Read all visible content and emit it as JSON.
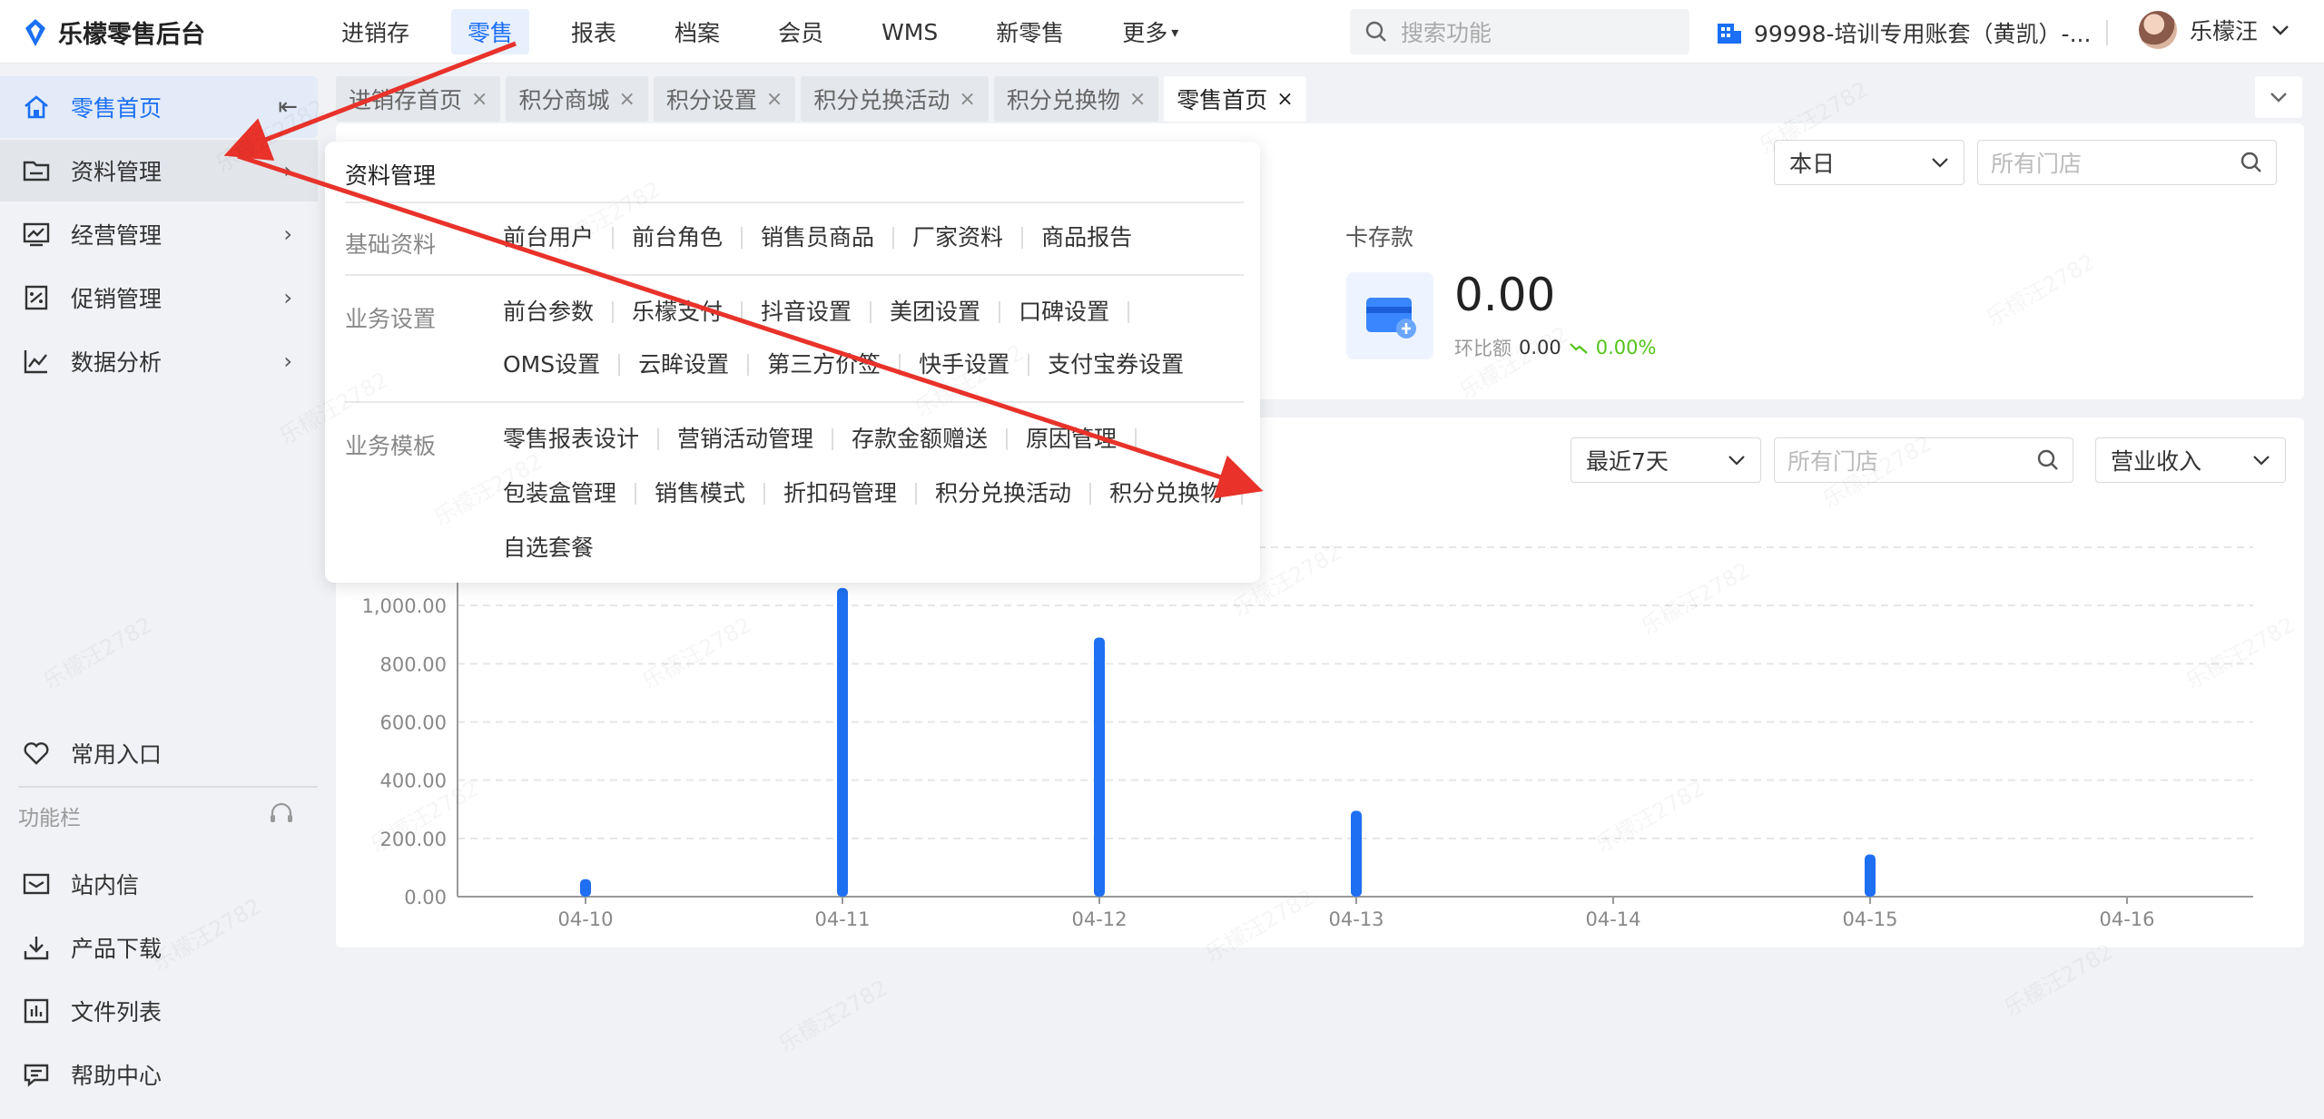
{
  "app": {
    "title": "乐檬零售后台"
  },
  "topnav": {
    "items": [
      {
        "label": "进销存"
      },
      {
        "label": "零售"
      },
      {
        "label": "报表"
      },
      {
        "label": "档案"
      },
      {
        "label": "会员"
      },
      {
        "label": "WMS"
      },
      {
        "label": "新零售"
      },
      {
        "label": "更多"
      }
    ],
    "search_placeholder": "搜索功能",
    "account": "99998-培训专用账套（黄凯）-...",
    "user": "乐檬汪"
  },
  "sidebar": {
    "items": [
      {
        "label": "零售首页"
      },
      {
        "label": "资料管理"
      },
      {
        "label": "经营管理"
      },
      {
        "label": "促销管理"
      },
      {
        "label": "数据分析"
      }
    ],
    "favorite": "常用入口",
    "section_label": "功能栏",
    "bottom": [
      {
        "label": "站内信"
      },
      {
        "label": "产品下载"
      },
      {
        "label": "文件列表"
      },
      {
        "label": "帮助中心"
      }
    ]
  },
  "tabs": [
    {
      "label": "进销存首页"
    },
    {
      "label": "积分商城"
    },
    {
      "label": "积分设置"
    },
    {
      "label": "积分兑换活动"
    },
    {
      "label": "积分兑换物"
    },
    {
      "label": "零售首页"
    }
  ],
  "summary": {
    "period": "本日",
    "store_placeholder": "所有门店",
    "card_label": "卡存款",
    "card_value": "0.00",
    "compare_label": "环比额",
    "compare_value": "0.00",
    "compare_pct": "0.00%"
  },
  "trend": {
    "period": "最近7天",
    "store_placeholder": "所有门店",
    "metric": "营业收入"
  },
  "dropdown": {
    "title": "资料管理",
    "groups": [
      {
        "name": "基础资料",
        "rows": [
          [
            "前台用户",
            "前台角色",
            "销售员商品",
            "厂家资料",
            "商品报告"
          ]
        ]
      },
      {
        "name": "业务设置",
        "rows": [
          [
            "前台参数",
            "乐檬支付",
            "抖音设置",
            "美团设置",
            "口碑设置"
          ],
          [
            "OMS设置",
            "云眸设置",
            "第三方价签",
            "快手设置",
            "支付宝券设置"
          ]
        ]
      },
      {
        "name": "业务模板",
        "rows": [
          [
            "零售报表设计",
            "营销活动管理",
            "存款金额赠送",
            "原因管理"
          ],
          [
            "包装盒管理",
            "销售模式",
            "折扣码管理",
            "积分兑换活动",
            "积分兑换物"
          ],
          [
            "自选套餐"
          ]
        ]
      }
    ]
  },
  "watermark": "乐檬汪2782",
  "colors": {
    "accent": "#1a6ff5",
    "bar": "#1f6ff2",
    "annotation": "#e8322a"
  },
  "chart_data": {
    "type": "bar",
    "categories": [
      "04-10",
      "04-11",
      "04-12",
      "04-13",
      "04-14",
      "04-15",
      "04-16"
    ],
    "values": [
      60,
      1060,
      890,
      295,
      0,
      145,
      0
    ],
    "yticks": [
      "0.00",
      "200.00",
      "400.00",
      "600.00",
      "800.00",
      "1,000.00"
    ],
    "ylim": [
      0,
      1200
    ],
    "grid": true
  }
}
